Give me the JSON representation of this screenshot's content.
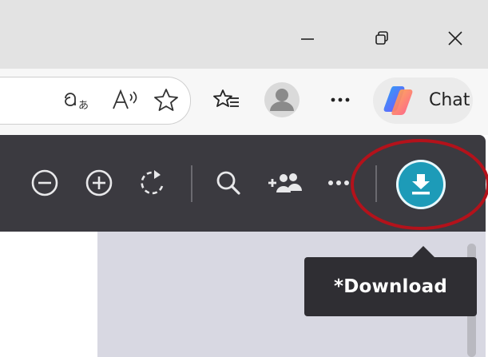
{
  "titlebar": {
    "minimize_icon": "minimize-icon",
    "restore_icon": "restore-icon",
    "close_icon": "close-icon"
  },
  "toolbar": {
    "icons": [
      "translate-icon",
      "read-aloud-icon",
      "favorite-star-icon",
      "favorites-list-icon",
      "profile-avatar-icon",
      "more-icon",
      "copilot-icon"
    ],
    "chat_label": "Chat"
  },
  "viewer": {
    "icons": [
      "zoom-out-icon",
      "zoom-in-icon",
      "rotate-icon",
      "search-icon",
      "share-people-icon",
      "more-icon",
      "download-icon"
    ],
    "colors": {
      "bar": "#3b3a40",
      "download_button": "#1d9bb8",
      "highlight_ring": "#b3121b"
    }
  },
  "tooltip": {
    "text": "*Download"
  }
}
